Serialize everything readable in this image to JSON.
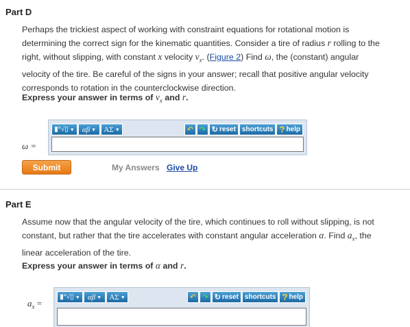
{
  "part_d": {
    "title": "Part D",
    "prompt_lines": [
      "Perhaps the trickiest aspect of working with constraint equations for rotational motion is",
      "determining the correct sign for the kinematic quantities. Consider a tire of radius",
      "rolling to the",
      "right, without slipping, with constant",
      "velocity",
      ".",
      "Figure 2",
      "Find",
      ", the (constant) angular",
      "velocity of the tire. Be careful of the signs in your answer; recall that positive angular velocity",
      "corresponds to rotation in the counterclockwise direction."
    ],
    "symbols": {
      "r": "r",
      "x": "x",
      "vx": "v",
      "vx_sub": "x",
      "omega": "ω"
    },
    "express": "Express your answer in terms of",
    "express_and": "and",
    "express_end": ".",
    "variable_label": "ω =",
    "toolbar": {
      "templates_btn": "▮°√▯",
      "greek_btn": "αβ",
      "symbols_btn": "ΑΣ",
      "undo_icon": "↶",
      "redo_icon": "↷",
      "reset_label": "reset",
      "shortcuts_label": "shortcuts",
      "help_label": "help",
      "help_icon": "?"
    },
    "input_value": "",
    "submit_label": "Submit",
    "my_answers_label": "My Answers",
    "give_up_label": "Give Up"
  },
  "part_e": {
    "title": "Part E",
    "prompt_lines": [
      "Assume now that the angular velocity of the tire, which continues to roll without slipping, is not",
      "constant, but rather that the tire accelerates with constant angular acceleration",
      ". Find",
      ", the",
      "linear acceleration of the tire."
    ],
    "symbols": {
      "alpha": "α",
      "ax": "a",
      "ax_sub": "x",
      "r": "r"
    },
    "express": "Express your answer in terms of",
    "express_and": "and",
    "express_end": ".",
    "variable_label": "a",
    "variable_sub": "x",
    "variable_eq": " =",
    "input_value": ""
  }
}
